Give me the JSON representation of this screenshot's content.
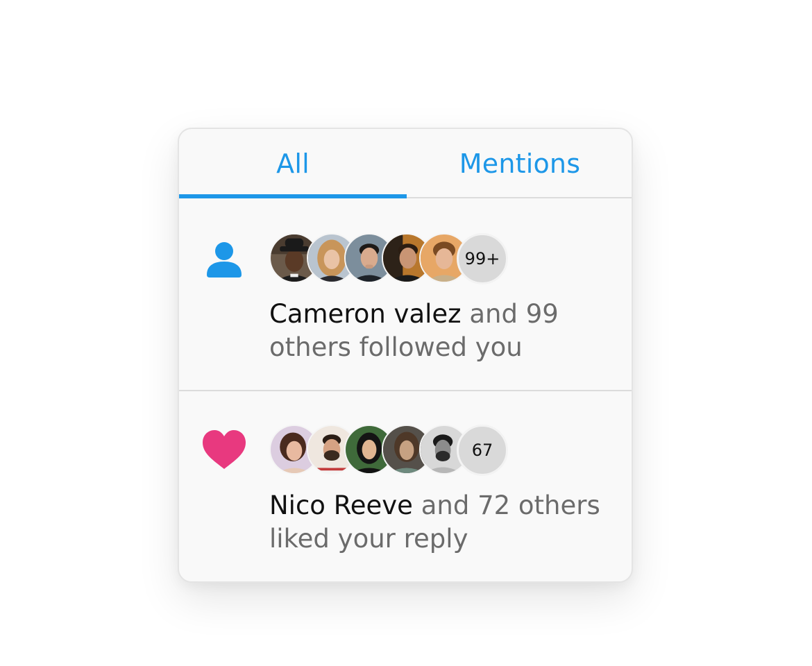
{
  "tabs": [
    {
      "label": "All",
      "active": true
    },
    {
      "label": "Mentions",
      "active": false
    }
  ],
  "colors": {
    "accent": "#1d97e8",
    "like": "#e8397f",
    "follow": "#1d97e8"
  },
  "notifications": [
    {
      "type": "follow",
      "icon": "user-icon",
      "actor": "Cameron valez",
      "message": " and 99 others followed you",
      "badge": "99+",
      "avatar_count": 5
    },
    {
      "type": "like",
      "icon": "heart-icon",
      "actor": "Nico Reeve",
      "message": " and 72 others liked your reply",
      "badge": "67",
      "avatar_count": 5
    }
  ]
}
